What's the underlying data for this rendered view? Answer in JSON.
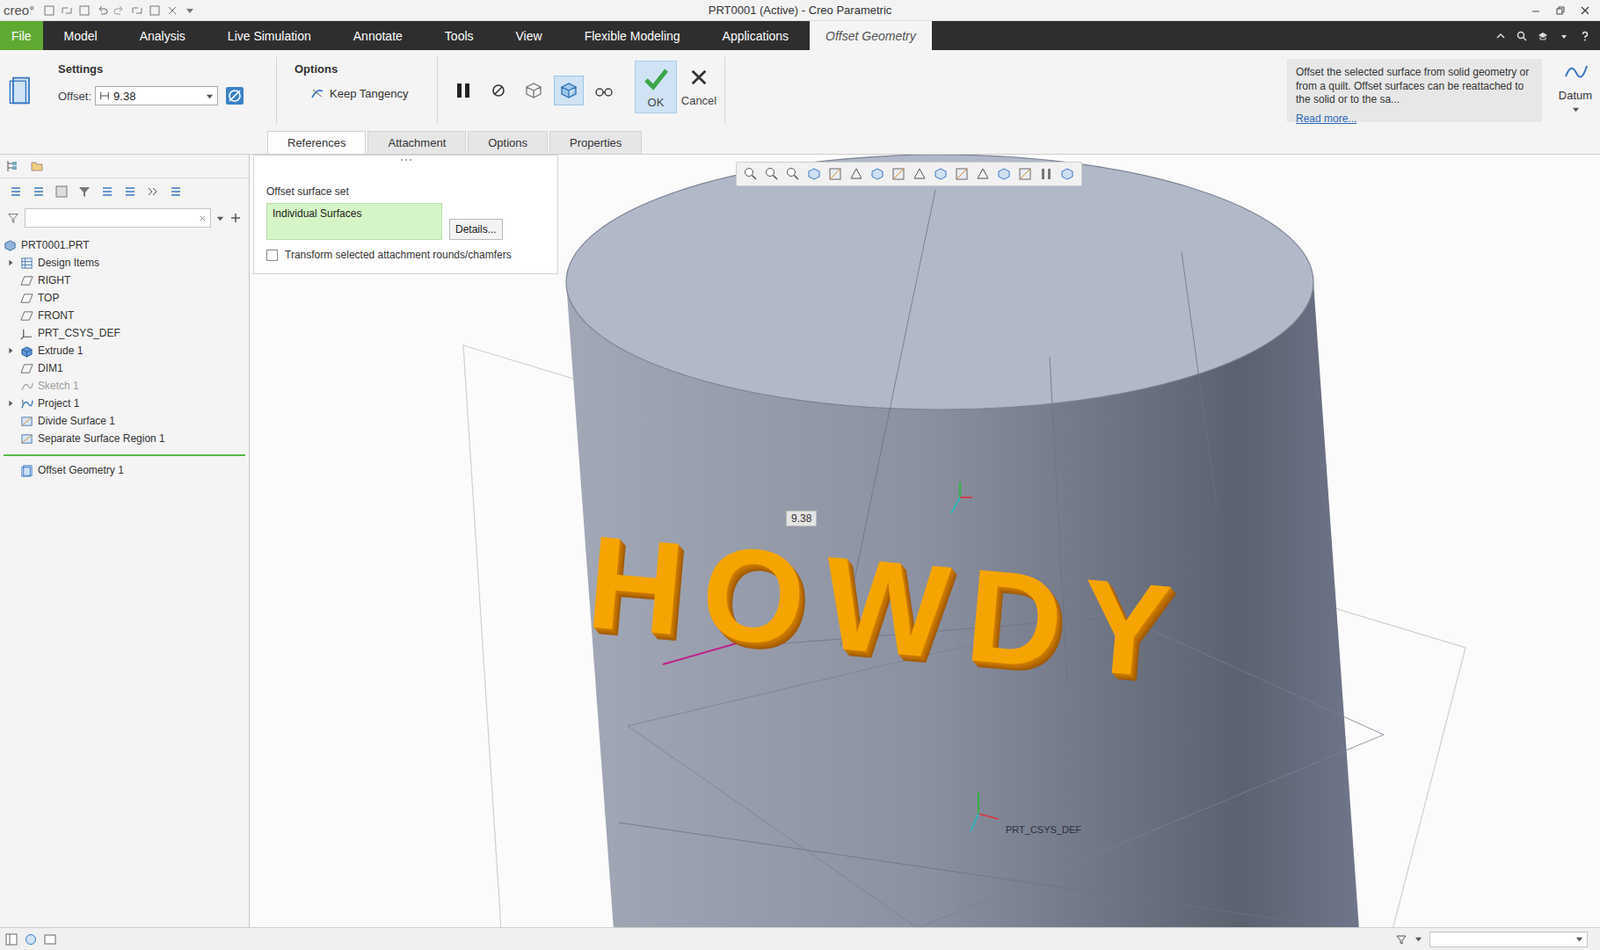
{
  "window": {
    "logo": "creo°",
    "title": "PRT0001 (Active) - Creo Parametric"
  },
  "menu_tabs": [
    {
      "label": "File",
      "kind": "file",
      "selected": false
    },
    {
      "label": "Model",
      "kind": "tab",
      "selected": false
    },
    {
      "label": "Analysis",
      "kind": "tab",
      "selected": false
    },
    {
      "label": "Live Simulation",
      "kind": "tab",
      "selected": false
    },
    {
      "label": "Annotate",
      "kind": "tab",
      "selected": false
    },
    {
      "label": "Tools",
      "kind": "tab",
      "selected": false
    },
    {
      "label": "View",
      "kind": "tab",
      "selected": false
    },
    {
      "label": "Flexible Modeling",
      "kind": "tab",
      "selected": false
    },
    {
      "label": "Applications",
      "kind": "tab",
      "selected": false
    },
    {
      "label": "Offset Geometry",
      "kind": "tab",
      "selected": true
    }
  ],
  "ribbon": {
    "settings_title": "Settings",
    "offset_label": "Offset:",
    "offset_value": "9.38",
    "options_title": "Options",
    "keep_tangency": "Keep Tangency",
    "ok": "OK",
    "cancel": "Cancel",
    "help_text": "Offset the selected surface from solid geometry or from a quilt. Offset surfaces can be reattached to the solid or to the sa...",
    "help_link": "Read more...",
    "datum": "Datum",
    "controls": [
      {
        "kind": "pause",
        "on": false
      },
      {
        "kind": "stop",
        "on": false
      },
      {
        "kind": "feature-preview",
        "on": false
      },
      {
        "kind": "geometry-preview",
        "on": true
      },
      {
        "kind": "verify",
        "on": false
      }
    ]
  },
  "sub_tabs": [
    {
      "label": "References",
      "selected": true
    },
    {
      "label": "Attachment",
      "selected": false
    },
    {
      "label": "Options",
      "selected": false
    },
    {
      "label": "Properties",
      "selected": false
    }
  ],
  "references_panel": {
    "set_label": "Offset surface set",
    "set_value": "Individual Surfaces",
    "details_button": "Details...",
    "transform_label": "Transform selected attachment rounds/chamfers",
    "transform_checked": false
  },
  "model_tree": [
    {
      "label": "PRT0001.PRT",
      "kind": "part",
      "expandable": false,
      "disabled": false,
      "pending": false
    },
    {
      "label": "Design Items",
      "kind": "group",
      "expandable": true,
      "disabled": false,
      "pending": false
    },
    {
      "label": "RIGHT",
      "kind": "plane",
      "expandable": false,
      "disabled": false,
      "pending": false
    },
    {
      "label": "TOP",
      "kind": "plane",
      "expandable": false,
      "disabled": false,
      "pending": false
    },
    {
      "label": "FRONT",
      "kind": "plane",
      "expandable": false,
      "disabled": false,
      "pending": false
    },
    {
      "label": "PRT_CSYS_DEF",
      "kind": "csys",
      "expandable": false,
      "disabled": false,
      "pending": false
    },
    {
      "label": "Extrude 1",
      "kind": "extrude",
      "expandable": true,
      "disabled": false,
      "pending": false
    },
    {
      "label": "DIM1",
      "kind": "plane",
      "expandable": false,
      "disabled": false,
      "pending": false
    },
    {
      "label": "Sketch 1",
      "kind": "sketch",
      "expandable": false,
      "disabled": true,
      "pending": false
    },
    {
      "label": "Project 1",
      "kind": "project",
      "expandable": true,
      "disabled": false,
      "pending": false
    },
    {
      "label": "Divide Surface 1",
      "kind": "surface",
      "expandable": false,
      "disabled": false,
      "pending": false
    },
    {
      "label": "Separate Surface Region 1",
      "kind": "surface",
      "expandable": false,
      "disabled": false,
      "pending": false
    },
    {
      "label": "Offset Geometry 1",
      "kind": "offset",
      "expandable": false,
      "disabled": false,
      "pending": true
    }
  ],
  "graphics": {
    "model_text": "HOWDY",
    "dimension": "9.38",
    "csys_label": "PRT_CSYS_DEF"
  }
}
